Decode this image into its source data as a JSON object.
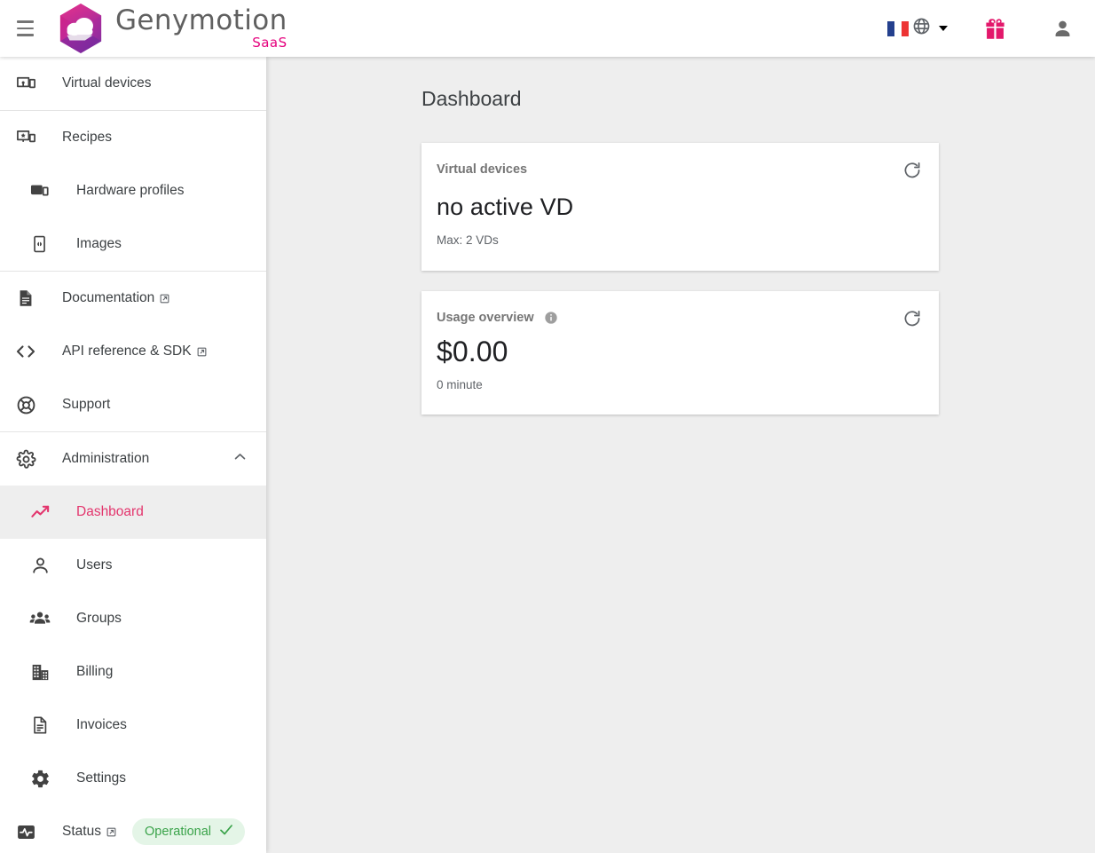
{
  "topbar": {
    "menu_icon": "hamburger-menu-icon",
    "brand": {
      "name": "Genymotion",
      "suffix": "SaaS"
    },
    "language": {
      "flag": "fr",
      "globe_icon": "globe-icon",
      "caret_icon": "chevron-down-icon"
    },
    "gift_icon": "gift-icon",
    "account_icon": "account-person-icon"
  },
  "sidebar": {
    "items": [
      {
        "label": "Virtual devices",
        "icon": "virtual-device-icon",
        "indent": 0,
        "external": false,
        "active": false
      },
      {
        "label": "Recipes",
        "icon": "recipes-icon",
        "indent": 0,
        "external": false,
        "active": false
      },
      {
        "label": "Hardware profiles",
        "icon": "hardware-profile-icon",
        "indent": 1,
        "external": false,
        "active": false
      },
      {
        "label": "Images",
        "icon": "images-icon",
        "indent": 1,
        "external": false,
        "active": false
      },
      {
        "label": "Documentation",
        "icon": "document-icon",
        "indent": 0,
        "external": true,
        "active": false
      },
      {
        "label": "API reference & SDK",
        "icon": "code-brackets-icon",
        "indent": 0,
        "external": true,
        "active": false
      },
      {
        "label": "Support",
        "icon": "lifebuoy-icon",
        "indent": 0,
        "external": false,
        "active": false
      },
      {
        "label": "Administration",
        "icon": "gear-icon",
        "indent": 0,
        "external": false,
        "active": false,
        "expanded": true
      },
      {
        "label": "Dashboard",
        "icon": "trending-up-icon",
        "indent": 1,
        "external": false,
        "active": true
      },
      {
        "label": "Users",
        "icon": "person-icon",
        "indent": 1,
        "external": false,
        "active": false
      },
      {
        "label": "Groups",
        "icon": "people-group-icon",
        "indent": 1,
        "external": false,
        "active": false
      },
      {
        "label": "Billing",
        "icon": "building-icon",
        "indent": 1,
        "external": false,
        "active": false
      },
      {
        "label": "Invoices",
        "icon": "invoice-document-icon",
        "indent": 1,
        "external": false,
        "active": false
      },
      {
        "label": "Settings",
        "icon": "settings-gear-icon",
        "indent": 1,
        "external": false,
        "active": false
      },
      {
        "label": "Status",
        "icon": "pulse-monitor-icon",
        "indent": 0,
        "external": true,
        "active": false
      }
    ],
    "status_badge": {
      "label": "Operational",
      "icon": "check-icon"
    }
  },
  "main": {
    "page_title": "Dashboard",
    "cards": [
      {
        "title": "Virtual devices",
        "value": "no active VD",
        "subtitle": "Max: 2 VDs",
        "refresh_icon": "refresh-icon",
        "has_info": false
      },
      {
        "title": "Usage overview",
        "value": "$0.00",
        "subtitle": "0 minute",
        "refresh_icon": "refresh-icon",
        "has_info": true,
        "info_icon": "info-icon"
      }
    ]
  },
  "colors": {
    "accent_pink": "#e3356d",
    "brand_magenta": "#e5007d",
    "status_green": "#3aa34a",
    "status_green_bg": "#e4f5e7",
    "page_bg": "#eeeeee",
    "card_bg": "#ffffff"
  }
}
